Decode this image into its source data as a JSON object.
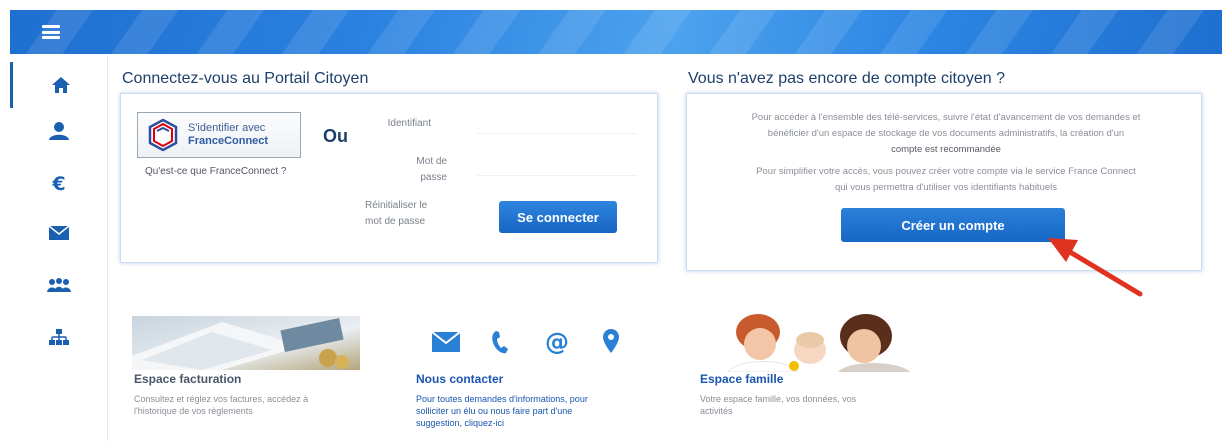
{
  "header": {
    "menu_icon": "hamburger-icon"
  },
  "sidebar": {
    "items": [
      {
        "icon": "home-icon",
        "active": true
      },
      {
        "icon": "user-icon"
      },
      {
        "icon": "euro-icon"
      },
      {
        "icon": "mail-icon"
      },
      {
        "icon": "group-icon"
      },
      {
        "icon": "sitemap-icon"
      }
    ]
  },
  "login": {
    "title": "Connectez-vous au Portail Citoyen",
    "fc_line1": "S'identifier avec",
    "fc_line2": "FranceConnect",
    "or_label": "Ou",
    "fc_what": "Qu'est-ce que FranceConnect ?",
    "id_label": "Identifiant",
    "pwd_label_1": "Mot de",
    "pwd_label_2": "passe",
    "reset_1": "Réinitialiser le",
    "reset_2": "mot de passe",
    "connect_label": "Se connecter"
  },
  "signup": {
    "title": "Vous n'avez pas encore de compte citoyen ?",
    "p1_line1": "Pour accéder à l'ensemble des télé-services, suivre l'état d'avancement de vos demandes et",
    "p1_line2": "bénéficier d'un espace de stockage de vos documents administratifs, la création d'un",
    "p1_line3": "compte est recommandée",
    "p2_line1": "Pour simplifier votre accès, vous pouvez créer votre compte via le service France Connect",
    "p2_line2": "qui vous permettra d'utiliser vos identifiants habituels",
    "create_label": "Créer un compte"
  },
  "tiles": [
    {
      "title": "Espace facturation",
      "desc_1": "Consultez et réglez vos factures, accédez à",
      "desc_2": "l'historique de vos règlements"
    },
    {
      "title": "Nous contacter",
      "desc_1": "Pour toutes demandes d'informations, pour",
      "desc_2": "solliciter un élu ou nous faire part d'une",
      "desc_3": "suggestion, cliquez-ici"
    },
    {
      "title": "Espace famille",
      "desc_1": "Votre espace famille, vos données, vos",
      "desc_2": "activités"
    }
  ],
  "colors": {
    "brand": "#1f6fd0",
    "title": "#1e3f6a",
    "accent_arrow": "#e0321e"
  }
}
